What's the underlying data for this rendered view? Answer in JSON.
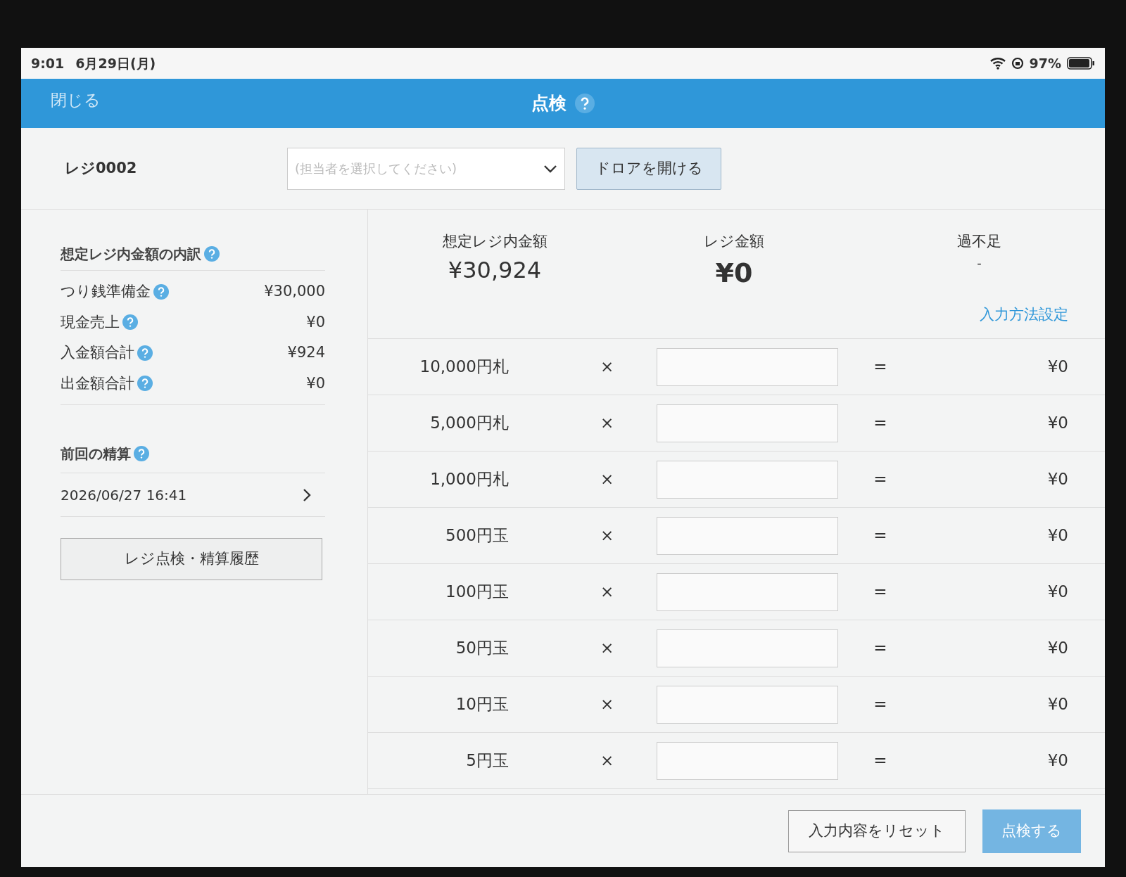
{
  "status_bar": {
    "time": "9:01",
    "date": "6月29日(月)",
    "battery": "97%"
  },
  "header": {
    "close": "閉じる",
    "title": "点検"
  },
  "toolbar": {
    "register": "レジ0002",
    "staff_select": {
      "placeholder": "(担当者を選択してください)"
    },
    "drawer_button": "ドロアを開ける"
  },
  "breakdown": {
    "title": "想定レジ内金額の内訳",
    "items": [
      {
        "label": "つり銭準備金",
        "value": "¥30,000"
      },
      {
        "label": "現金売上",
        "value": "¥0"
      },
      {
        "label": "入金額合計",
        "value": "¥924"
      },
      {
        "label": "出金額合計",
        "value": "¥0"
      }
    ]
  },
  "previous": {
    "title": "前回の精算",
    "date": "2026/06/27 16:41"
  },
  "history_button": "レジ点検・精算履歴",
  "summary": [
    {
      "label": "想定レジ内金額",
      "value": "¥30,924",
      "bold": false
    },
    {
      "label": "レジ金額",
      "value": "¥0",
      "bold": true
    },
    {
      "label": "過不足",
      "value": "-",
      "bold": false
    }
  ],
  "input_settings_link": "入力方法設定",
  "denominations": [
    {
      "label": "10,000円札",
      "multiply": "×",
      "equals": "=",
      "total": "¥0"
    },
    {
      "label": "5,000円札",
      "multiply": "×",
      "equals": "=",
      "total": "¥0"
    },
    {
      "label": "1,000円札",
      "multiply": "×",
      "equals": "=",
      "total": "¥0"
    },
    {
      "label": "500円玉",
      "multiply": "×",
      "equals": "=",
      "total": "¥0"
    },
    {
      "label": "100円玉",
      "multiply": "×",
      "equals": "=",
      "total": "¥0"
    },
    {
      "label": "50円玉",
      "multiply": "×",
      "equals": "=",
      "total": "¥0"
    },
    {
      "label": "10円玉",
      "multiply": "×",
      "equals": "=",
      "total": "¥0"
    },
    {
      "label": "5円玉",
      "multiply": "×",
      "equals": "=",
      "total": "¥0"
    }
  ],
  "footer": {
    "reset": "入力内容をリセット",
    "submit": {
      "label": "点検する",
      "disabled": true
    }
  }
}
